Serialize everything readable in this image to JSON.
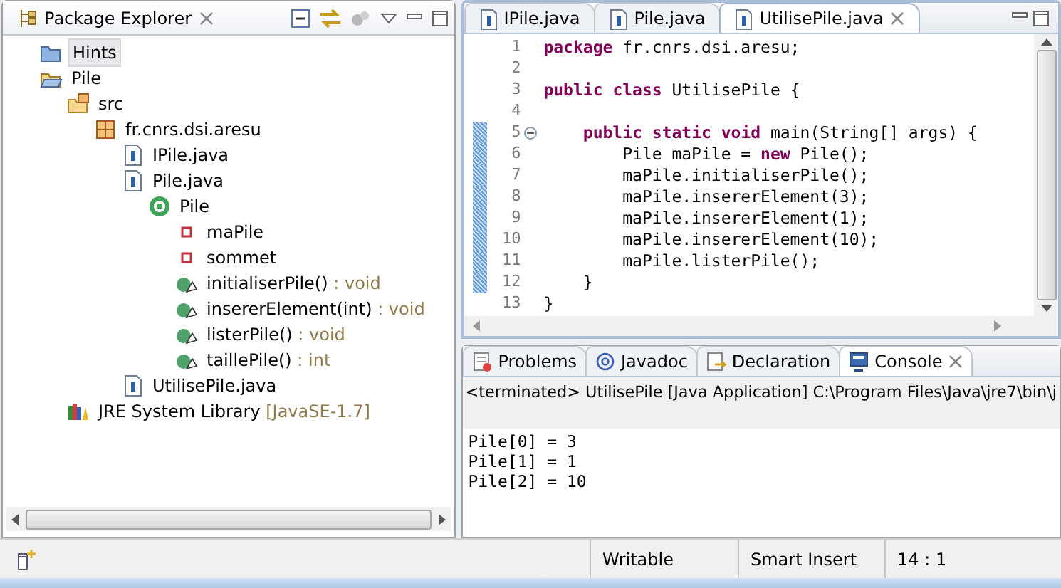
{
  "package_explorer": {
    "title": "Package Explorer",
    "tree": [
      {
        "kind": "folder",
        "label": "Hints",
        "selected": true
      },
      {
        "kind": "project",
        "label": "Pile",
        "selected": false,
        "children": [
          {
            "kind": "source-folder",
            "label": "src",
            "selected": false,
            "children": [
              {
                "kind": "package",
                "label": "fr.cnrs.dsi.aresu",
                "selected": false,
                "children": [
                  {
                    "kind": "java-file",
                    "label": "IPile.java",
                    "selected": false
                  },
                  {
                    "kind": "java-file",
                    "label": "Pile.java",
                    "selected": false,
                    "children": [
                      {
                        "kind": "class",
                        "label": "Pile",
                        "selected": false,
                        "children": [
                          {
                            "kind": "field",
                            "label": "maPile",
                            "selected": false
                          },
                          {
                            "kind": "field",
                            "label": "sommet",
                            "selected": false
                          },
                          {
                            "kind": "method",
                            "label": "initialiserPile()",
                            "suffix": " : void",
                            "selected": false
                          },
                          {
                            "kind": "method",
                            "label": "insererElement(int)",
                            "suffix": " : void",
                            "selected": false
                          },
                          {
                            "kind": "method",
                            "label": "listerPile()",
                            "suffix": " : void",
                            "selected": false
                          },
                          {
                            "kind": "method",
                            "label": "taillePile()",
                            "suffix": " : int",
                            "selected": false
                          }
                        ]
                      }
                    ]
                  },
                  {
                    "kind": "java-file",
                    "label": "UtilisePile.java",
                    "selected": false
                  }
                ]
              }
            ]
          },
          {
            "kind": "library",
            "label": "JRE System Library",
            "suffix": " [JavaSE-1.7]",
            "selected": false
          }
        ]
      }
    ]
  },
  "editor": {
    "tabs": [
      {
        "label": "IPile.java",
        "selected": false
      },
      {
        "label": "Pile.java",
        "selected": false
      },
      {
        "label": "UtilisePile.java",
        "selected": true
      }
    ],
    "lines": [
      {
        "number": "1",
        "changed": false,
        "code": "**package** fr.cnrs.dsi.aresu;"
      },
      {
        "number": "2",
        "changed": false
      },
      {
        "number": "3",
        "changed": false,
        "code": "**public** **class** UtilisePile {"
      },
      {
        "number": "4",
        "changed": false
      },
      {
        "number": "5",
        "changed": true,
        "foldable": true,
        "code": "    **public** **static** **void** main(String[] args) {"
      },
      {
        "number": "6",
        "changed": true,
        "code": "        Pile maPile = **new** Pile();"
      },
      {
        "number": "7",
        "changed": true,
        "code": "        maPile.initialiserPile();"
      },
      {
        "number": "8",
        "changed": true,
        "code": "        maPile.insererElement(3);"
      },
      {
        "number": "9",
        "changed": true,
        "code": "        maPile.insererElement(1);"
      },
      {
        "number": "10",
        "changed": true,
        "code": "        maPile.insererElement(10);"
      },
      {
        "number": "11",
        "changed": true,
        "code": "        maPile.listerPile();"
      },
      {
        "number": "12",
        "changed": true,
        "code": "    }"
      },
      {
        "number": "13",
        "changed": false,
        "code": "}"
      }
    ]
  },
  "bottom_panel": {
    "tabs": [
      {
        "kind": "problems",
        "label": "Problems",
        "selected": false
      },
      {
        "kind": "javadoc",
        "label": "Javadoc",
        "selected": false
      },
      {
        "kind": "declaration",
        "label": "Declaration",
        "selected": false
      },
      {
        "kind": "console",
        "label": "Console",
        "selected": true
      }
    ],
    "header": "<terminated> UtilisePile [Java Application] C:\\Program Files\\Java\\jre7\\bin\\j",
    "output": [
      "Pile[0] = 3",
      "Pile[1] = 1",
      "Pile[2] = 10"
    ]
  },
  "status_bar": [
    "Writable",
    "Smart Insert",
    "14 : 1"
  ]
}
